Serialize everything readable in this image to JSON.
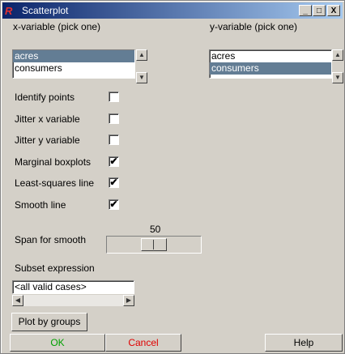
{
  "window": {
    "title": "Scatterplot",
    "app_logo_text": "R",
    "minimize_label": "_",
    "maximize_label": "□",
    "close_label": "X"
  },
  "xvar": {
    "label": "x-variable (pick one)",
    "items": [
      "acres",
      "consumers"
    ],
    "selected": "acres"
  },
  "yvar": {
    "label": "y-variable (pick one)",
    "items": [
      "acres",
      "consumers"
    ],
    "selected": "consumers"
  },
  "options": [
    {
      "label": "Identify points",
      "checked": false
    },
    {
      "label": "Jitter x variable",
      "checked": false
    },
    {
      "label": "Jitter y variable",
      "checked": false
    },
    {
      "label": "Marginal boxplots",
      "checked": true
    },
    {
      "label": "Least-squares line",
      "checked": true
    },
    {
      "label": "Smooth line",
      "checked": true
    }
  ],
  "span": {
    "label": "Span for smooth",
    "value": "50"
  },
  "subset": {
    "label": "Subset expression",
    "value": "<all valid cases>"
  },
  "buttons": {
    "plot_by_groups": "Plot by groups",
    "ok": "OK",
    "cancel": "Cancel",
    "help": "Help"
  },
  "colors": {
    "ok": "#00a000",
    "cancel": "#e00000",
    "selection": "#637d94"
  },
  "icons": {
    "check": "✔",
    "arrow_up": "▲",
    "arrow_down": "▼",
    "arrow_left": "◀",
    "arrow_right": "▶"
  }
}
